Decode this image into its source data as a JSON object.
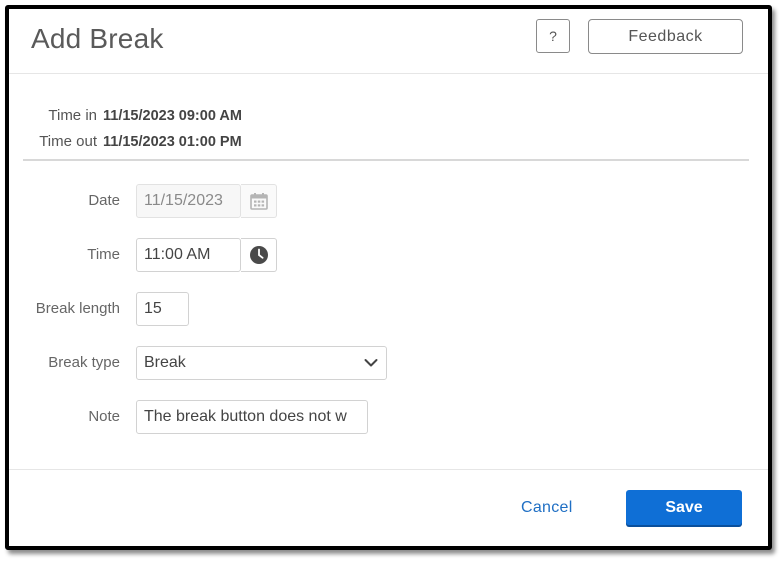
{
  "dialog": {
    "title": "Add Break",
    "help_label": "?",
    "feedback_label": "Feedback"
  },
  "shift": {
    "time_in_label": "Time in",
    "time_in_value": "11/15/2023 09:00 AM",
    "time_out_label": "Time out",
    "time_out_value": "11/15/2023 01:00 PM"
  },
  "form": {
    "date": {
      "label": "Date",
      "value": "11/15/2023",
      "icon": "calendar-icon"
    },
    "time": {
      "label": "Time",
      "value": "11:00 AM",
      "icon": "clock-icon"
    },
    "break_length": {
      "label": "Break length",
      "value": "15"
    },
    "break_type": {
      "label": "Break type",
      "value": "Break",
      "icon": "chevron-down-icon"
    },
    "note": {
      "label": "Note",
      "value": "The break button does not w"
    }
  },
  "footer": {
    "cancel_label": "Cancel",
    "save_label": "Save"
  },
  "colors": {
    "primary": "#0f6fd6",
    "link": "#1f6fc4"
  }
}
